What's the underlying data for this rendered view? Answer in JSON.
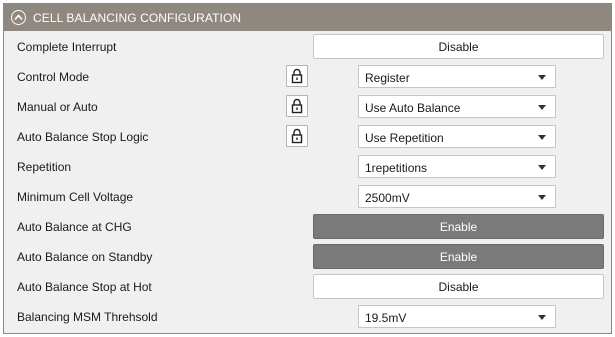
{
  "header": {
    "title": "CELL BALANCING CONFIGURATION"
  },
  "rows": [
    {
      "label": "Complete Interrupt",
      "control": "button",
      "value": "Disable",
      "active": false
    },
    {
      "label": "Control Mode",
      "control": "select",
      "value": "Register",
      "locked": true
    },
    {
      "label": "Manual or Auto",
      "control": "select",
      "value": "Use Auto Balance",
      "locked": true
    },
    {
      "label": "Auto Balance Stop Logic",
      "control": "select",
      "value": "Use Repetition",
      "locked": true
    },
    {
      "label": "Repetition",
      "control": "select",
      "value": "1repetitions"
    },
    {
      "label": "Minimum Cell Voltage",
      "control": "select",
      "value": "2500mV"
    },
    {
      "label": "Auto Balance at CHG",
      "control": "button",
      "value": "Enable",
      "active": true
    },
    {
      "label": "Auto Balance on Standby",
      "control": "button",
      "value": "Enable",
      "active": true
    },
    {
      "label": "Auto Balance Stop at Hot",
      "control": "button",
      "value": "Disable",
      "active": false
    },
    {
      "label": "Balancing MSM Threhsold",
      "control": "select",
      "value": "19.5mV"
    }
  ],
  "colors": {
    "header_bg": "#8f8880",
    "panel_bg": "#f0f0f0",
    "active_button_bg": "#7a7a7a"
  },
  "icons": {
    "collapse": "chevron-up-circle-icon",
    "lock": "padlock-icon"
  }
}
